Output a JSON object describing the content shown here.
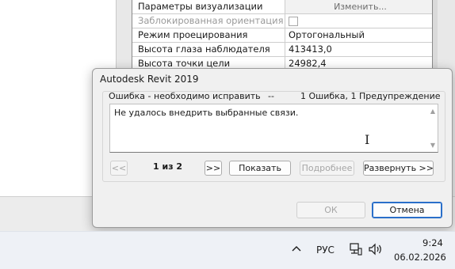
{
  "properties": {
    "rows": [
      {
        "name": "Параметры визуализации",
        "value": "Изменить..."
      },
      {
        "name": "Заблокированная ориентация",
        "value": ""
      },
      {
        "name": "Режим проецирования",
        "value": "Ортогональный"
      },
      {
        "name": "Высота глаза наблюдателя",
        "value": "413413,0"
      },
      {
        "name": "Высота точки цели",
        "value": "24982,4"
      }
    ]
  },
  "dialog": {
    "title": "Autodesk Revit 2019",
    "group_caption": "Ошибка - необходимо исправить",
    "group_dash": "--",
    "group_count": "1 Ошибка, 1 Предупреждение",
    "message": "Не удалось внедрить выбранные связи.",
    "nav": {
      "prev": "<<",
      "counter": "1 из 2",
      "next": ">>"
    },
    "buttons": {
      "show": "Показать",
      "details": "Подробнее",
      "expand": "Развернуть >>",
      "ok": "ОК",
      "cancel": "Отмена"
    }
  },
  "taskbar": {
    "language": "РУС",
    "time": "9:24",
    "date": "06.02.2026",
    "icons": [
      "chevron-up-icon",
      "network-icon",
      "volume-icon"
    ]
  },
  "colors": {
    "accent": "#2a6fc9"
  }
}
